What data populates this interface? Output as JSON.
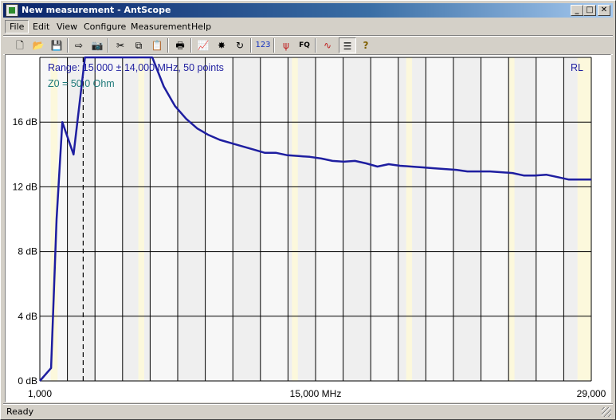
{
  "window": {
    "title": "New measurement - AntScope",
    "minimize_glyph": "_",
    "maximize_glyph": "□",
    "close_glyph": "✕"
  },
  "menu": [
    "File",
    "Edit",
    "View",
    "Configure",
    "Measurement",
    "Help"
  ],
  "toolbar": [
    {
      "name": "new-icon",
      "glyph": "🗋"
    },
    {
      "name": "open-icon",
      "glyph": "📂"
    },
    {
      "name": "save-icon",
      "glyph": "💾"
    },
    {
      "name": "export-icon",
      "glyph": "⇨"
    },
    {
      "name": "camera-icon",
      "glyph": "📷"
    },
    {
      "name": "cut-icon",
      "glyph": "✂"
    },
    {
      "name": "copy-icon",
      "glyph": "⧉"
    },
    {
      "name": "paste-icon",
      "glyph": "📋"
    },
    {
      "name": "print-icon",
      "glyph": "🖶"
    },
    {
      "name": "chart-icon",
      "glyph": "📈"
    },
    {
      "name": "scan-icon",
      "glyph": "✸"
    },
    {
      "name": "refresh-icon",
      "glyph": "↻"
    },
    {
      "name": "numbers-icon",
      "glyph": "123"
    },
    {
      "name": "antenna-icon",
      "glyph": "ψ"
    },
    {
      "name": "frequency-icon",
      "glyph": "FQ"
    },
    {
      "name": "overlay-icon",
      "glyph": "∿"
    },
    {
      "name": "list-icon",
      "glyph": "☰"
    },
    {
      "name": "help-icon",
      "glyph": "?"
    }
  ],
  "status": "Ready",
  "chart_data": {
    "type": "line",
    "range_label": "Range: 15,000 ± 14,000 MHz, 50 points",
    "z0_label": "Z0 = 50,0 Ohm",
    "mode_label": "RL",
    "xlim": [
      1,
      29
    ],
    "ylim": [
      0,
      20
    ],
    "x_ticks": [
      1,
      15,
      29
    ],
    "x_tick_labels": [
      "1,000",
      "15,000 MHz",
      "29,000"
    ],
    "y_ticks": [
      0,
      4,
      8,
      12,
      16
    ],
    "y_tick_labels": [
      "0 dB",
      "4 dB",
      "8 dB",
      "12 dB",
      "16 dB"
    ],
    "marker_x": 3.2,
    "line_color": "#1e1ea0",
    "series": [
      {
        "x": [
          1.0,
          1.57,
          1.85,
          2.14,
          2.71,
          3.29,
          3.86,
          4.43,
          5.0,
          5.57,
          6.14,
          6.71,
          7.29,
          7.86,
          8.43,
          9.0,
          9.57,
          10.14,
          10.71,
          11.29,
          11.86,
          12.43,
          13.0,
          13.57,
          14.14,
          14.71,
          15.29,
          15.86,
          16.43,
          17.0,
          17.57,
          18.14,
          18.71,
          19.29,
          19.86,
          20.43,
          21.0,
          21.57,
          22.14,
          22.71,
          23.29,
          23.86,
          24.43,
          25.0,
          25.57,
          26.14,
          26.71,
          27.29,
          27.86,
          28.43,
          29.0
        ],
        "y": [
          0.0,
          0.8,
          10.0,
          16.0,
          14.0,
          20.0,
          20.0,
          20.0,
          20.0,
          20.0,
          20.0,
          20.0,
          18.2,
          17.0,
          16.2,
          15.6,
          15.2,
          14.9,
          14.7,
          14.5,
          14.3,
          14.1,
          14.1,
          13.95,
          13.9,
          13.85,
          13.75,
          13.6,
          13.55,
          13.6,
          13.45,
          13.25,
          13.4,
          13.3,
          13.25,
          13.2,
          13.15,
          13.1,
          13.05,
          12.95,
          12.95,
          12.95,
          12.9,
          12.85,
          12.7,
          12.7,
          12.75,
          12.6,
          12.45,
          12.45,
          12.45
        ]
      }
    ]
  }
}
